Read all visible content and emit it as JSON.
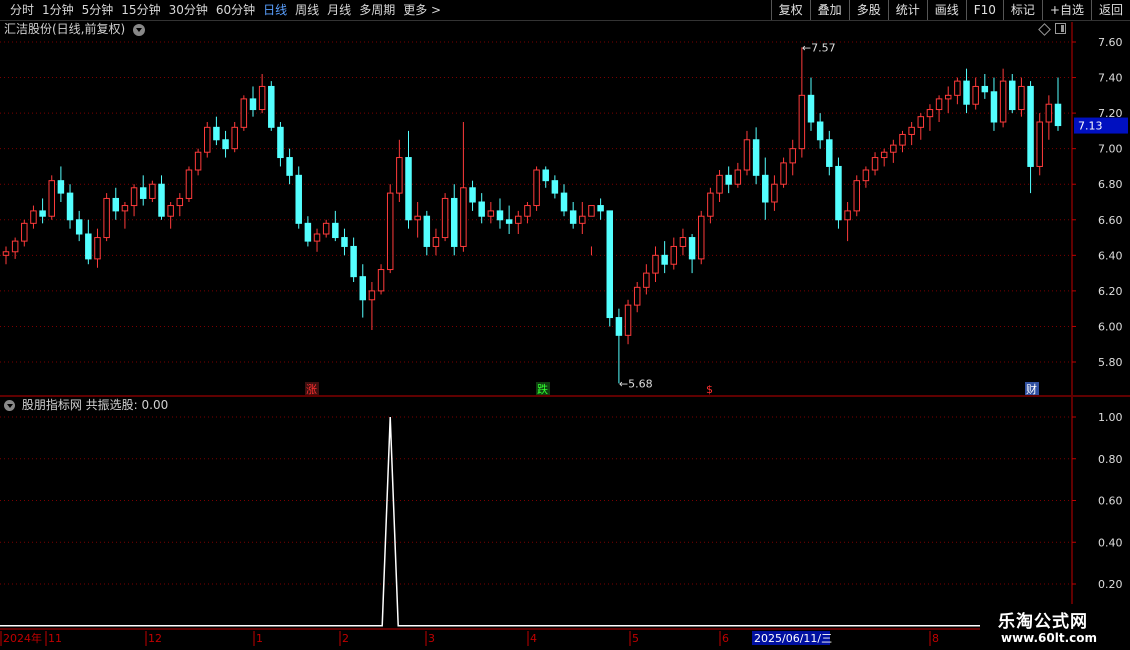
{
  "toolbar": {
    "periods": [
      "分时",
      "1分钟",
      "5分钟",
      "15分钟",
      "30分钟",
      "60分钟",
      "日线",
      "周线",
      "月线",
      "多周期",
      "更多 >"
    ],
    "active_period": "日线",
    "buttons": [
      "复权",
      "叠加",
      "多股",
      "统计",
      "画线",
      "F10",
      "标记",
      "+自选",
      "返回"
    ]
  },
  "main_chart": {
    "title": "汇洁股份(日线,前复权)",
    "y_ticks": [
      "7.60",
      "7.40",
      "7.20",
      "7.00",
      "6.80",
      "6.60",
      "6.40",
      "6.20",
      "6.00",
      "5.80"
    ],
    "current_price": "7.13",
    "high_label": "7.57",
    "low_label": "5.68",
    "markers": [
      {
        "text": "涨",
        "color": "#ff3030",
        "bg": "#401010"
      },
      {
        "text": "跌",
        "color": "#30ff30",
        "bg": "#104010"
      },
      {
        "text": "$",
        "color": "#ff3030",
        "bg": "#000000"
      },
      {
        "text": "财",
        "color": "#ffffff",
        "bg": "#3050a0"
      }
    ]
  },
  "indicator": {
    "title": "股朋指标网 共振选股: 0.00",
    "y_ticks": [
      "1.00",
      "0.80",
      "0.60",
      "0.40",
      "0.20"
    ]
  },
  "time_axis": {
    "labels": [
      "2024年",
      "11",
      "12",
      "1",
      "2",
      "3",
      "4",
      "5",
      "6",
      "8"
    ],
    "cursor_date": "2025/06/11/三"
  },
  "watermark": {
    "line1": "乐淘公式网",
    "line2": "www.60lt.com"
  },
  "colors": {
    "up": "#ff3b3b",
    "down": "#54ffff",
    "grid": "#7a0000",
    "axis": "#c00000",
    "active": "#5aa0ff"
  },
  "chart_data": {
    "type": "candlestick",
    "ylim": [
      5.65,
      7.65
    ],
    "candles": [
      [
        6.4,
        6.45,
        6.35,
        6.42
      ],
      [
        6.42,
        6.5,
        6.38,
        6.48
      ],
      [
        6.48,
        6.6,
        6.45,
        6.58
      ],
      [
        6.58,
        6.68,
        6.55,
        6.65
      ],
      [
        6.65,
        6.72,
        6.58,
        6.62
      ],
      [
        6.62,
        6.85,
        6.6,
        6.82
      ],
      [
        6.82,
        6.9,
        6.7,
        6.75
      ],
      [
        6.75,
        6.8,
        6.55,
        6.6
      ],
      [
        6.6,
        6.65,
        6.48,
        6.52
      ],
      [
        6.52,
        6.6,
        6.35,
        6.38
      ],
      [
        6.38,
        6.55,
        6.33,
        6.5
      ],
      [
        6.5,
        6.75,
        6.48,
        6.72
      ],
      [
        6.72,
        6.78,
        6.6,
        6.65
      ],
      [
        6.65,
        6.7,
        6.55,
        6.68
      ],
      [
        6.68,
        6.8,
        6.62,
        6.78
      ],
      [
        6.78,
        6.85,
        6.68,
        6.72
      ],
      [
        6.72,
        6.82,
        6.7,
        6.8
      ],
      [
        6.8,
        6.85,
        6.6,
        6.62
      ],
      [
        6.62,
        6.7,
        6.55,
        6.68
      ],
      [
        6.68,
        6.75,
        6.62,
        6.72
      ],
      [
        6.72,
        6.9,
        6.7,
        6.88
      ],
      [
        6.88,
        7.0,
        6.85,
        6.98
      ],
      [
        6.98,
        7.15,
        6.95,
        7.12
      ],
      [
        7.12,
        7.18,
        7.02,
        7.05
      ],
      [
        7.05,
        7.1,
        6.95,
        7.0
      ],
      [
        7.0,
        7.15,
        6.98,
        7.12
      ],
      [
        7.12,
        7.3,
        7.1,
        7.28
      ],
      [
        7.28,
        7.35,
        7.18,
        7.22
      ],
      [
        7.22,
        7.42,
        7.2,
        7.35
      ],
      [
        7.35,
        7.38,
        7.1,
        7.12
      ],
      [
        7.12,
        7.15,
        6.9,
        6.95
      ],
      [
        6.95,
        7.0,
        6.8,
        6.85
      ],
      [
        6.85,
        6.9,
        6.55,
        6.58
      ],
      [
        6.58,
        6.62,
        6.45,
        6.48
      ],
      [
        6.48,
        6.55,
        6.42,
        6.52
      ],
      [
        6.52,
        6.6,
        6.5,
        6.58
      ],
      [
        6.58,
        6.65,
        6.48,
        6.5
      ],
      [
        6.5,
        6.55,
        6.4,
        6.45
      ],
      [
        6.45,
        6.5,
        6.25,
        6.28
      ],
      [
        6.28,
        6.35,
        6.05,
        6.15
      ],
      [
        6.15,
        6.25,
        5.98,
        6.2
      ],
      [
        6.2,
        6.35,
        6.18,
        6.32
      ],
      [
        6.32,
        6.8,
        6.3,
        6.75
      ],
      [
        6.75,
        7.05,
        6.7,
        6.95
      ],
      [
        6.95,
        7.1,
        6.55,
        6.6
      ],
      [
        6.6,
        6.7,
        6.5,
        6.62
      ],
      [
        6.62,
        6.65,
        6.4,
        6.45
      ],
      [
        6.45,
        6.55,
        6.4,
        6.5
      ],
      [
        6.5,
        6.75,
        6.48,
        6.72
      ],
      [
        6.72,
        6.8,
        6.4,
        6.45
      ],
      [
        6.45,
        7.15,
        6.42,
        6.78
      ],
      [
        6.78,
        6.82,
        6.65,
        6.7
      ],
      [
        6.7,
        6.75,
        6.58,
        6.62
      ],
      [
        6.62,
        6.7,
        6.58,
        6.65
      ],
      [
        6.65,
        6.72,
        6.55,
        6.6
      ],
      [
        6.6,
        6.68,
        6.52,
        6.58
      ],
      [
        6.58,
        6.65,
        6.52,
        6.62
      ],
      [
        6.62,
        6.7,
        6.58,
        6.68
      ],
      [
        6.68,
        6.9,
        6.65,
        6.88
      ],
      [
        6.88,
        6.9,
        6.78,
        6.82
      ],
      [
        6.82,
        6.85,
        6.72,
        6.75
      ],
      [
        6.75,
        6.8,
        6.62,
        6.65
      ],
      [
        6.65,
        6.7,
        6.55,
        6.58
      ],
      [
        6.58,
        6.7,
        6.52,
        6.62
      ],
      [
        6.62,
        6.45,
        6.4,
        6.68
      ],
      [
        6.68,
        6.72,
        6.6,
        6.65
      ],
      [
        6.65,
        6.1,
        6.0,
        6.05
      ],
      [
        6.05,
        6.1,
        5.68,
        5.95
      ],
      [
        5.95,
        6.15,
        5.9,
        6.12
      ],
      [
        6.12,
        6.25,
        6.08,
        6.22
      ],
      [
        6.22,
        6.35,
        6.18,
        6.3
      ],
      [
        6.3,
        6.45,
        6.25,
        6.4
      ],
      [
        6.4,
        6.48,
        6.3,
        6.35
      ],
      [
        6.35,
        6.5,
        6.32,
        6.45
      ],
      [
        6.45,
        6.55,
        6.4,
        6.5
      ],
      [
        6.5,
        6.52,
        6.3,
        6.38
      ],
      [
        6.38,
        6.65,
        6.35,
        6.62
      ],
      [
        6.62,
        6.78,
        6.58,
        6.75
      ],
      [
        6.75,
        6.88,
        6.7,
        6.85
      ],
      [
        6.85,
        6.9,
        6.75,
        6.8
      ],
      [
        6.8,
        6.92,
        6.78,
        6.88
      ],
      [
        6.88,
        7.1,
        6.85,
        7.05
      ],
      [
        7.05,
        7.12,
        6.8,
        6.85
      ],
      [
        6.85,
        6.95,
        6.6,
        6.7
      ],
      [
        6.7,
        6.85,
        6.65,
        6.8
      ],
      [
        6.8,
        6.95,
        6.78,
        6.92
      ],
      [
        6.92,
        7.05,
        6.85,
        7.0
      ],
      [
        7.0,
        7.57,
        6.95,
        7.3
      ],
      [
        7.3,
        7.4,
        7.1,
        7.15
      ],
      [
        7.15,
        7.2,
        7.0,
        7.05
      ],
      [
        7.05,
        7.1,
        6.85,
        6.9
      ],
      [
        6.9,
        6.95,
        6.55,
        6.6
      ],
      [
        6.6,
        6.7,
        6.48,
        6.65
      ],
      [
        6.65,
        6.85,
        6.62,
        6.82
      ],
      [
        6.82,
        6.9,
        6.78,
        6.88
      ],
      [
        6.88,
        6.98,
        6.85,
        6.95
      ],
      [
        6.95,
        7.0,
        6.9,
        6.98
      ],
      [
        6.98,
        7.05,
        6.92,
        7.02
      ],
      [
        7.02,
        7.1,
        6.98,
        7.08
      ],
      [
        7.08,
        7.15,
        7.02,
        7.12
      ],
      [
        7.12,
        7.2,
        7.05,
        7.18
      ],
      [
        7.18,
        7.25,
        7.1,
        7.22
      ],
      [
        7.22,
        7.3,
        7.15,
        7.28
      ],
      [
        7.28,
        7.35,
        7.2,
        7.3
      ],
      [
        7.3,
        7.4,
        7.25,
        7.38
      ],
      [
        7.38,
        7.45,
        7.2,
        7.25
      ],
      [
        7.25,
        7.4,
        7.22,
        7.35
      ],
      [
        7.35,
        7.42,
        7.28,
        7.32
      ],
      [
        7.32,
        7.4,
        7.1,
        7.15
      ],
      [
        7.15,
        7.45,
        7.12,
        7.38
      ],
      [
        7.38,
        7.42,
        7.2,
        7.22
      ],
      [
        7.22,
        7.4,
        7.18,
        7.35
      ],
      [
        7.35,
        7.38,
        6.75,
        6.9
      ],
      [
        6.9,
        7.2,
        6.85,
        7.15
      ],
      [
        7.15,
        7.3,
        7.05,
        7.25
      ],
      [
        7.25,
        7.4,
        7.1,
        7.13
      ]
    ],
    "indicator_series": {
      "name": "共振选股",
      "spike_index": 42,
      "spike_value": 1.0,
      "baseline": 0.0
    }
  }
}
